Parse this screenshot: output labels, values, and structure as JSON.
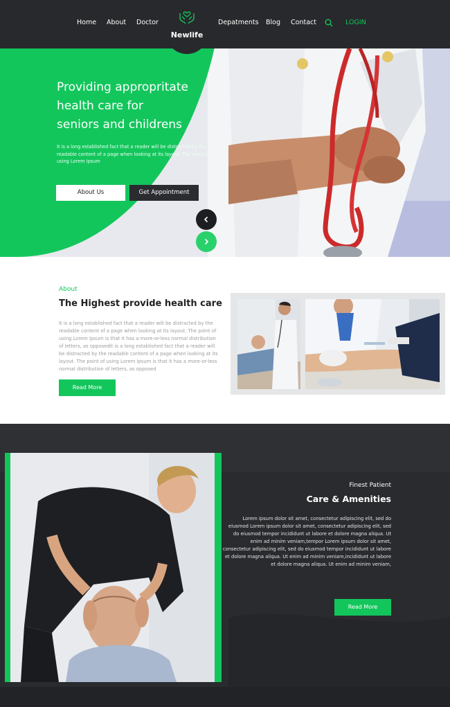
{
  "brand": {
    "name": "Newlife",
    "accent": "#13c65c",
    "dark": "#28292c"
  },
  "nav": {
    "left": [
      "Home",
      "About",
      "Doctor"
    ],
    "right": [
      "Depatments",
      "Blog",
      "Contact"
    ],
    "login": "LOGIN",
    "search_icon": "search-icon"
  },
  "hero": {
    "title_lines": [
      "Providing appropritate",
      "health care for",
      "seniors and childrens"
    ],
    "text": "It is a long established fact that a reader will be distracted by the readable content of a page when looking at its layout. The point of using Lorem Ipsum",
    "btn_about": "About Us",
    "btn_appointment": "Get Appointment"
  },
  "about": {
    "label": "About",
    "title": "The Highest provide health care",
    "text": "It is a long established fact that a reader will be distracted by the readable content of a page when looking at its layout. The point of using Lorem Ipsum is that it has a more-or-less normal distribution of letters, as opposedit is a long established fact that a reader will be distracted by the readable content of a page when looking at its layout. The point of using Lorem Ipsum is that it has a more-or-less normal distribution of letters, as opposed",
    "btn": "Read More"
  },
  "amenities": {
    "label": "Finest Patient",
    "title": "Care & Amenities",
    "text": "Lorem ipsum dolor sit amet, consectetur adipiscing elit, sed do eiusmod Lorem ipsum dolor sit amet, consectetur adipiscing elit, sed do eiusmod tempor incididunt ut labore et dolore magna aliqua. Ut enim ad minim veniam,tempor Lorem ipsum dolor sit amet, consectetur adipiscing elit, sed do eiusmod tempor incididunt ut labore et dolore magna aliqua. Ut enim ad minim veniam,incididunt ut labore et dolore magna aliqua. Ut enim ad minim veniam,",
    "btn": "Read More"
  }
}
